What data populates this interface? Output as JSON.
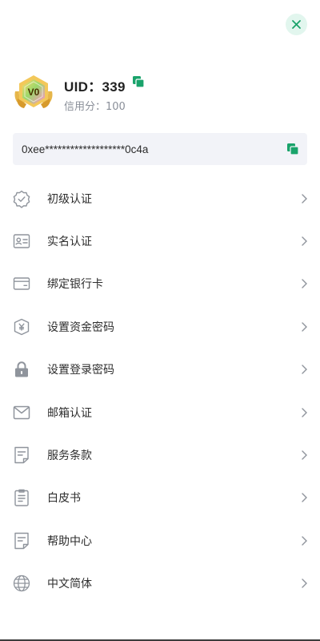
{
  "header": {
    "close_icon": "close-icon"
  },
  "profile": {
    "level_badge": "V0",
    "uid_text": "UID：339",
    "credit_text": "信用分：100",
    "copy_icon": "copy-icon"
  },
  "wallet": {
    "address": "0xee*******************0c4a",
    "copy_icon": "copy-icon"
  },
  "colors": {
    "accent": "#1aa36b",
    "close_bg": "#e2f6ee",
    "address_bg": "#f2f3f8",
    "icon_gray": "#8f949c",
    "text_secondary": "#8a8f99"
  },
  "menu": {
    "items": [
      {
        "label": "初级认证",
        "icon": "verified-badge-icon"
      },
      {
        "label": "实名认证",
        "icon": "id-card-icon"
      },
      {
        "label": "绑定银行卡",
        "icon": "bank-card-icon"
      },
      {
        "label": "设置资金密码",
        "icon": "yen-shield-icon"
      },
      {
        "label": "设置登录密码",
        "icon": "lock-icon"
      },
      {
        "label": "邮箱认证",
        "icon": "mail-icon"
      },
      {
        "label": "服务条款",
        "icon": "document-icon"
      },
      {
        "label": "白皮书",
        "icon": "clipboard-icon"
      },
      {
        "label": "帮助中心",
        "icon": "help-document-icon"
      },
      {
        "label": "中文简体",
        "icon": "globe-icon"
      }
    ]
  }
}
